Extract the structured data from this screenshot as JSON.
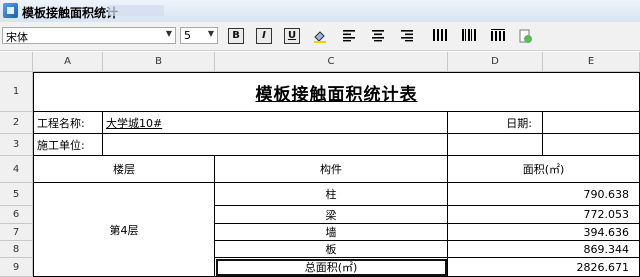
{
  "window": {
    "title": "模板接触面积统计"
  },
  "toolbar": {
    "font_name": "宋体",
    "font_size": "5",
    "buttons": [
      {
        "name": "bold-button",
        "label": "B"
      },
      {
        "name": "italic-button",
        "label": "I"
      },
      {
        "name": "underline-button",
        "label": "U"
      }
    ]
  },
  "columns": [
    "A",
    "B",
    "C",
    "D",
    "E"
  ],
  "rows": [
    "1",
    "2",
    "3",
    "4",
    "5",
    "6",
    "7",
    "8",
    "9"
  ],
  "sheet": {
    "title": "模板接触面积统计表",
    "project_label": "工程名称:",
    "project_value": "大学城10#",
    "date_label": "日期:",
    "unit_label": "施工单位:",
    "header_floor": "楼层",
    "header_component": "构件",
    "header_area": "面积(㎡)",
    "floor_value": "第4层",
    "items": [
      {
        "component": "柱",
        "area": "790.638"
      },
      {
        "component": "梁",
        "area": "772.053"
      },
      {
        "component": "墙",
        "area": "394.636"
      },
      {
        "component": "板",
        "area": "869.344"
      }
    ],
    "total_label": "总面积(㎡)",
    "total_value": "2826.671"
  }
}
